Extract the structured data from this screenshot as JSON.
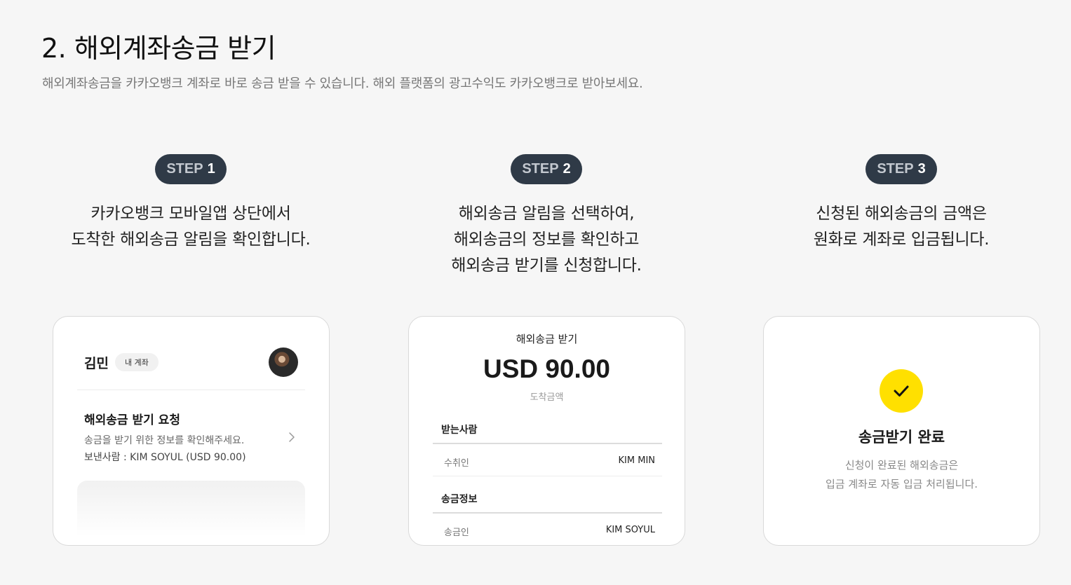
{
  "header": {
    "title": "2. 해외계좌송금 받기",
    "subtitle": "해외계좌송금을 카카오뱅크 계좌로 바로 송금 받을 수 있습니다. 해외 플랫폼의 광고수익도 카카오뱅크로 받아보세요."
  },
  "steps": [
    {
      "word": "STEP",
      "num": "1",
      "desc": "카카오뱅크 모바일앱 상단에서\n도착한 해외송금 알림을 확인합니다."
    },
    {
      "word": "STEP",
      "num": "2",
      "desc": "해외송금 알림을 선택하여,\n해외송금의 정보를 확인하고\n해외송금 받기를 신청합니다."
    },
    {
      "word": "STEP",
      "num": "3",
      "desc": "신청된 해외송금의 금액은\n원화로 계좌로 입금됩니다."
    }
  ],
  "card1": {
    "name": "김민",
    "chip": "내 계좌",
    "request_title": "해외송금 받기 요청",
    "request_line1": "송금을 받기 위한 정보를 확인해주세요.",
    "request_line2": "보낸사람 : KIM SOYUL (USD 90.00)"
  },
  "card2": {
    "title": "해외송금 받기",
    "amount": "USD 90.00",
    "amount_label": "도착금액",
    "recipient_section": "받는사람",
    "recipient_key": "수취인",
    "recipient_value": "KIM MIN",
    "transfer_section": "송금정보",
    "sender_key": "송금인",
    "sender_value": "KIM SOYUL"
  },
  "card3": {
    "title": "송금받기 완료",
    "desc_line1": "신청이 완료된 해외송금은",
    "desc_line2": "입금 계좌로 자동 입금 처리됩니다."
  },
  "colors": {
    "background": "#f6f6f6",
    "step_badge": "#2f3a47",
    "accent_yellow": "#ffe000"
  },
  "icons": [
    "chevron-right-icon",
    "check-icon",
    "avatar"
  ]
}
